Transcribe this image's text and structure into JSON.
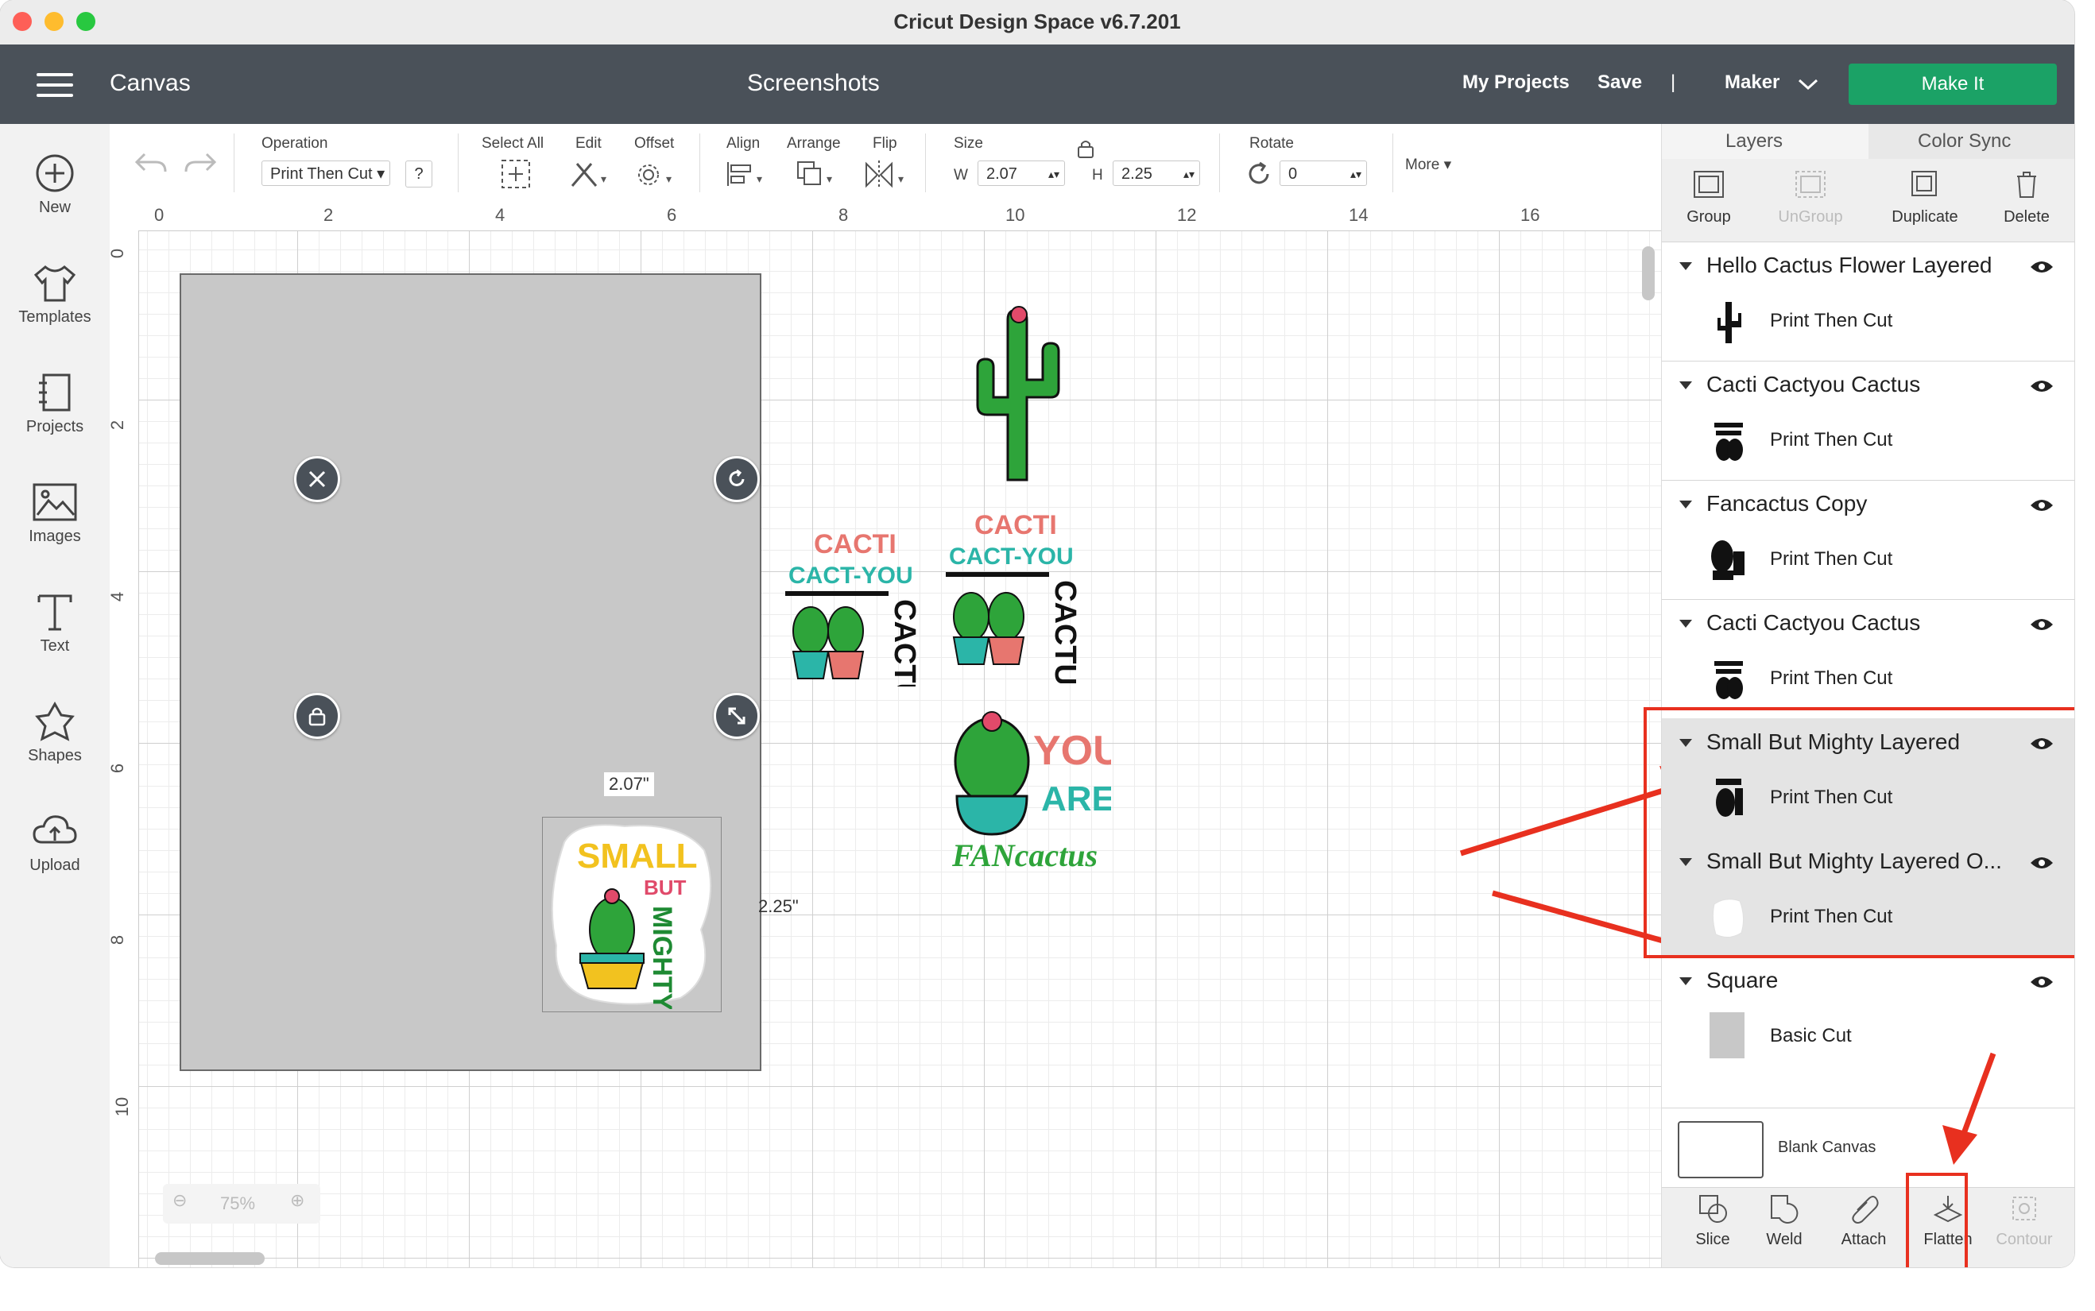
{
  "window": {
    "title": "Cricut Design Space  v6.7.201"
  },
  "header": {
    "canvas_label": "Canvas",
    "project_name": "Screenshots",
    "my_projects": "My Projects",
    "save": "Save",
    "separator": "|",
    "machine": "Maker",
    "make_it": "Make It",
    "accent_color": "#1ba266"
  },
  "leftbar": {
    "items": [
      {
        "label": "New",
        "icon": "plus-circle-icon"
      },
      {
        "label": "Templates",
        "icon": "shirt-icon"
      },
      {
        "label": "Projects",
        "icon": "notebook-icon"
      },
      {
        "label": "Images",
        "icon": "image-icon"
      },
      {
        "label": "Text",
        "icon": "text-icon"
      },
      {
        "label": "Shapes",
        "icon": "shapes-icon"
      },
      {
        "label": "Upload",
        "icon": "cloud-upload-icon"
      }
    ]
  },
  "toolbar": {
    "operation_label": "Operation",
    "operation_value": "Print Then Cut",
    "help": "?",
    "select_all": "Select All",
    "edit": "Edit",
    "offset": "Offset",
    "align": "Align",
    "arrange": "Arrange",
    "flip": "Flip",
    "size": "Size",
    "w_label": "W",
    "w_value": "2.07",
    "h_label": "H",
    "h_value": "2.25",
    "rotate": "Rotate",
    "rotate_value": "0",
    "more": "More"
  },
  "canvas": {
    "ruler_top": [
      "0",
      "2",
      "4",
      "6",
      "8",
      "10",
      "12",
      "14",
      "16"
    ],
    "ruler_left": [
      "0",
      "2",
      "4",
      "6",
      "8",
      "10"
    ],
    "selection_width": "2.07\"",
    "selection_height": "2.25\"",
    "zoom": "75%",
    "sticker_texts": {
      "cacti": "CACTI",
      "cact_you": "CACT-YOU",
      "cactus": "CACTUS",
      "you": "YOU",
      "are": "ARE",
      "fancactus": "FANcactus",
      "small": "SMALL",
      "but": "BUT",
      "mighty": "MIGHTY"
    }
  },
  "panel": {
    "tabs": [
      "Layers",
      "Color Sync"
    ],
    "actions": [
      "Group",
      "UnGroup",
      "Duplicate",
      "Delete"
    ],
    "layers": [
      {
        "title": "Hello Cactus Flower Layered",
        "op": "Print Then Cut"
      },
      {
        "title": "Cacti Cactyou Cactus",
        "op": "Print Then Cut"
      },
      {
        "title": "Fancactus Copy",
        "op": "Print Then Cut"
      },
      {
        "title": "Cacti Cactyou Cactus",
        "op": "Print Then Cut"
      },
      {
        "title": "Small But Mighty Layered",
        "op": "Print Then Cut"
      },
      {
        "title": "Small But Mighty Layered O...",
        "op": "Print Then Cut"
      },
      {
        "title": "Square",
        "op": "Basic Cut"
      }
    ],
    "blank_canvas": "Blank Canvas",
    "bottom_actions": [
      "Slice",
      "Weld",
      "Attach",
      "Flatten",
      "Contour"
    ]
  },
  "annotation_color": "#e8301f"
}
